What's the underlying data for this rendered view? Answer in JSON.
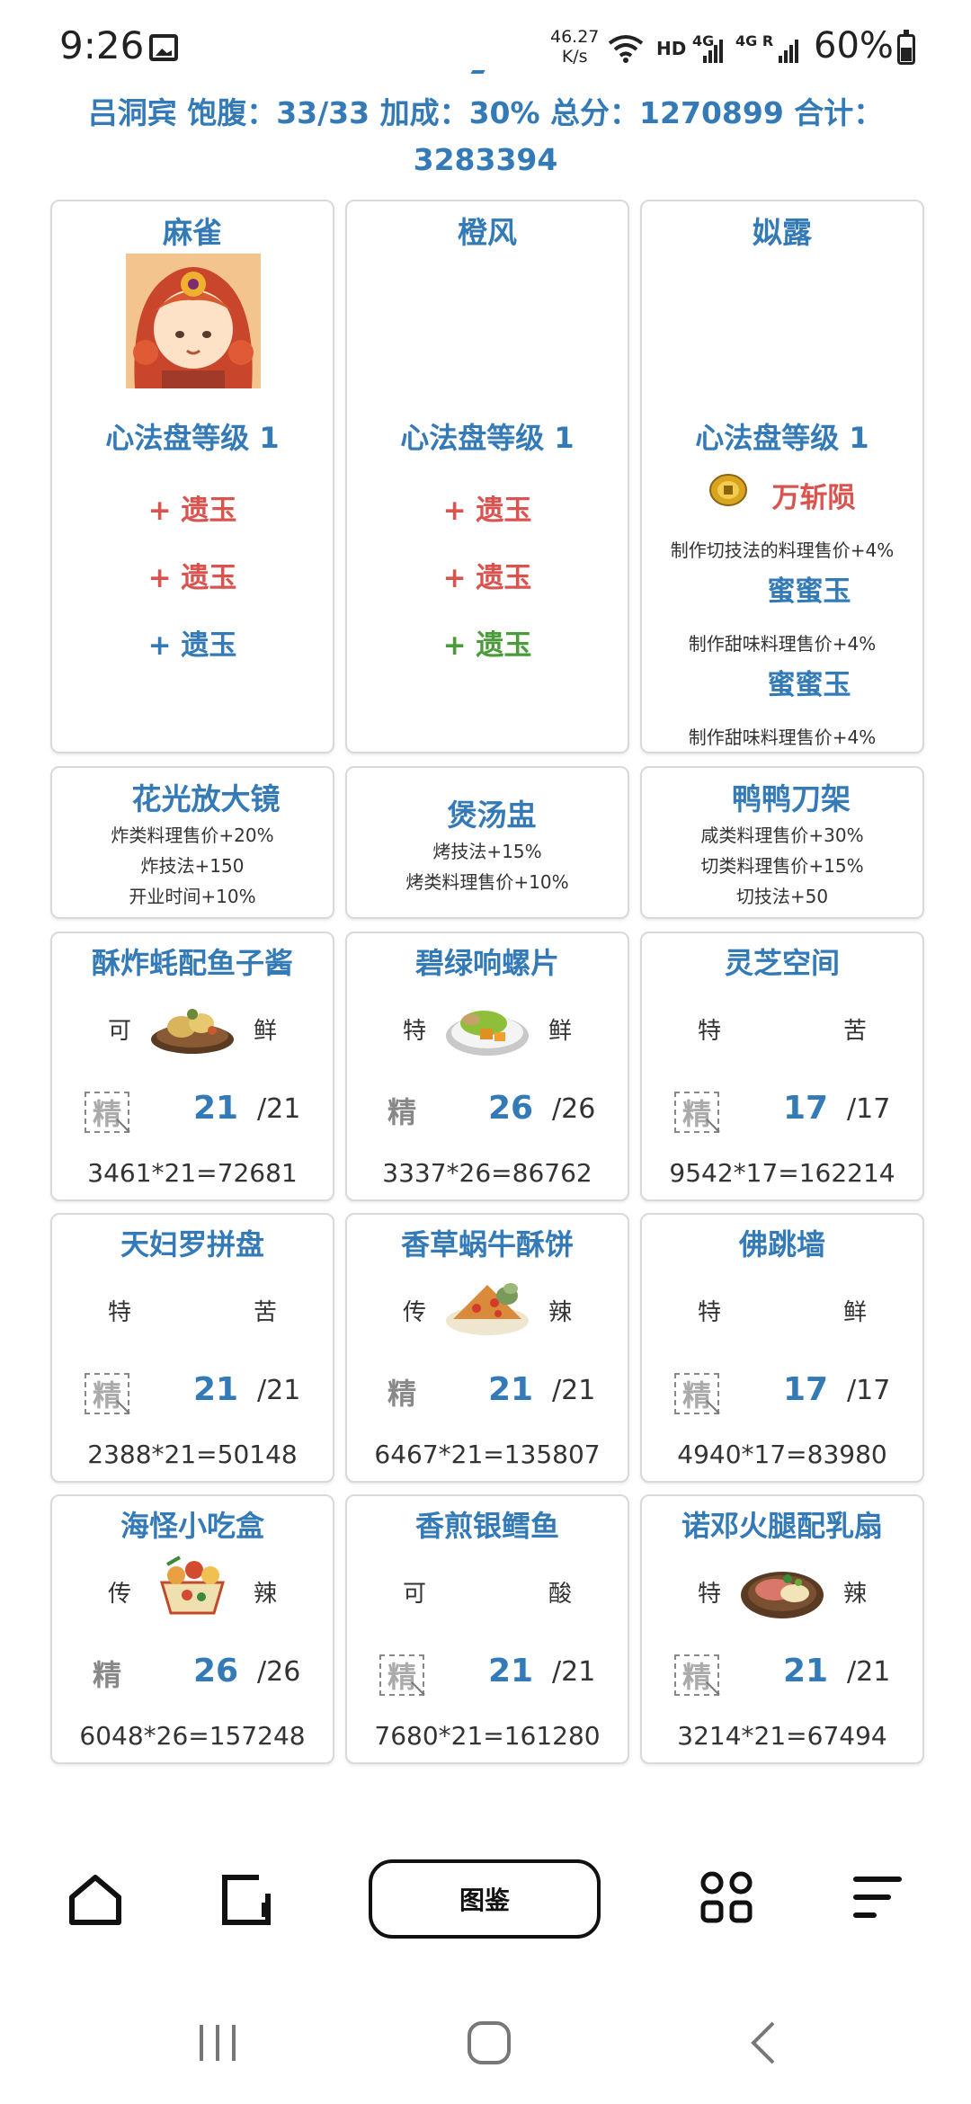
{
  "status_bar": {
    "time": "9:26",
    "speed_value": "46.27",
    "speed_unit": "K/s",
    "hd": "HD",
    "net1": "4G",
    "net2": "4G R",
    "battery": "60%"
  },
  "header": {
    "line1": "吕洞宾 饱腹：33/33 加成：30% 总分：1270899 合计：",
    "line2": "3283394"
  },
  "chefs": [
    {
      "name": "麻雀",
      "level": "心法盘等级 1",
      "has_portrait": true,
      "jades": [
        {
          "label": "+ 遗玉",
          "color": "red"
        },
        {
          "label": "+ 遗玉",
          "color": "red"
        },
        {
          "label": "+ 遗玉",
          "color": "blue"
        }
      ]
    },
    {
      "name": "橙风",
      "level": "心法盘等级 1",
      "has_portrait": false,
      "jades": [
        {
          "label": "+ 遗玉",
          "color": "red"
        },
        {
          "label": "+ 遗玉",
          "color": "red"
        },
        {
          "label": "+ 遗玉",
          "color": "green"
        }
      ]
    },
    {
      "name": "姒露",
      "level": "心法盘等级 1",
      "has_portrait": false,
      "skills": [
        {
          "name": "万斩陨",
          "desc": "制作切技法的料理售价+4%",
          "color": "red"
        },
        {
          "name": "蜜蜜玉",
          "desc": "制作甜味料理售价+4%",
          "color": "blue"
        },
        {
          "name": "蜜蜜玉",
          "desc": "制作甜味料理售价+4%",
          "color": "blue"
        }
      ]
    }
  ],
  "equipment": [
    {
      "name": "花光放大镜",
      "lines": [
        "炸类料理售价+20%",
        "炸技法+150",
        "开业时间+10%"
      ]
    },
    {
      "name": "煲汤盅",
      "lines": [
        "烤技法+15%",
        "烤类料理售价+10%"
      ]
    },
    {
      "name": "鸭鸭刀架",
      "lines": [
        "咸类料理售价+30%",
        "切类料理售价+15%",
        "切技法+50"
      ]
    }
  ],
  "recipes": [
    {
      "name": "酥炸蚝配鱼子酱",
      "rarity": "可",
      "flavor": "鲜",
      "jing": "精",
      "jing_dashed": true,
      "count": "21",
      "limit": "/21",
      "formula": "3461*21=72681",
      "dish": "oyster"
    },
    {
      "name": "碧绿响螺片",
      "rarity": "特",
      "flavor": "鲜",
      "jing": "精",
      "jing_dashed": false,
      "count": "26",
      "limit": "/26",
      "formula": "3337*26=86762",
      "dish": "conch"
    },
    {
      "name": "灵芝空间",
      "rarity": "特",
      "flavor": "苦",
      "jing": "精",
      "jing_dashed": true,
      "count": "17",
      "limit": "/17",
      "formula": "9542*17=162214",
      "dish": ""
    },
    {
      "name": "天妇罗拼盘",
      "rarity": "特",
      "flavor": "苦",
      "jing": "精",
      "jing_dashed": true,
      "count": "21",
      "limit": "/21",
      "formula": "2388*21=50148",
      "dish": ""
    },
    {
      "name": "香草蜗牛酥饼",
      "rarity": "传",
      "flavor": "辣",
      "jing": "精",
      "jing_dashed": false,
      "count": "21",
      "limit": "/21",
      "formula": "6467*21=135807",
      "dish": "snail"
    },
    {
      "name": "佛跳墙",
      "rarity": "特",
      "flavor": "鲜",
      "jing": "精",
      "jing_dashed": true,
      "count": "17",
      "limit": "/17",
      "formula": "4940*17=83980",
      "dish": ""
    },
    {
      "name": "海怪小吃盒",
      "rarity": "传",
      "flavor": "辣",
      "jing": "精",
      "jing_dashed": false,
      "count": "26",
      "limit": "/26",
      "formula": "6048*26=157248",
      "dish": "box"
    },
    {
      "name": "香煎银鳕鱼",
      "rarity": "可",
      "flavor": "酸",
      "jing": "精",
      "jing_dashed": true,
      "count": "21",
      "limit": "/21",
      "formula": "7680*21=161280",
      "dish": ""
    },
    {
      "name": "诺邓火腿配乳扇",
      "rarity": "特",
      "flavor": "辣",
      "jing": "精",
      "jing_dashed": true,
      "count": "21",
      "limit": "/21",
      "formula": "3214*21=67494",
      "dish": "ham"
    }
  ],
  "bottom_nav": {
    "center_label": "图鉴",
    "icons": [
      "home-icon",
      "tabs-icon",
      "grid-icon",
      "menu-icon"
    ]
  },
  "system_nav": {
    "icons": [
      "recents-icon",
      "home-circle-icon",
      "back-icon"
    ]
  },
  "colors": {
    "accent_blue": "#337ab7",
    "jade_red": "#d9534f",
    "jade_green": "#4a9b3a",
    "card_border": "#d9d9d9"
  }
}
